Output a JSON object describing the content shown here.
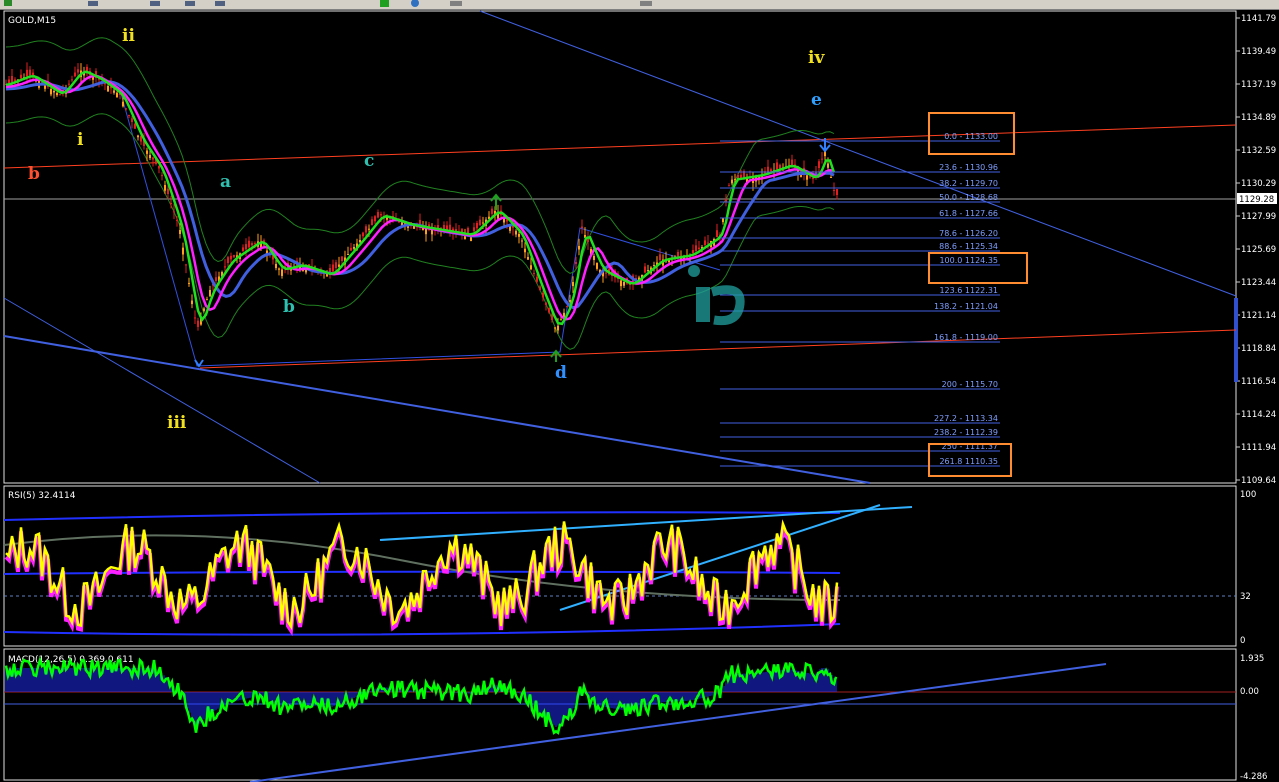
{
  "toolbar": {
    "buttons": [
      "arrow-icon",
      "zoom-icon",
      "crosshair-icon",
      "text-icon",
      "line-icon",
      "add-icon",
      "refresh-icon",
      "period-icon",
      "nav-icon"
    ]
  },
  "chart_title": "GOLD,M15",
  "price_axis": [
    "1141.79",
    "1139.49",
    "1137.19",
    "1134.89",
    "1132.59",
    "1130.29",
    "1127.99",
    "1125.69",
    "1123.44",
    "1121.14",
    "1118.84",
    "1116.54",
    "1114.24",
    "1111.94",
    "1109.64"
  ],
  "current_price": "1129.28",
  "wave_labels": [
    {
      "text": "ii",
      "color": "#f0e020"
    },
    {
      "text": "i",
      "color": "#f0e020"
    },
    {
      "text": "b",
      "color": "#ff5030"
    },
    {
      "text": "a",
      "color": "#30c0b0"
    },
    {
      "text": "c",
      "color": "#30c0b0"
    },
    {
      "text": "b",
      "color": "#30c0b0"
    },
    {
      "text": "iii",
      "color": "#f0e020"
    },
    {
      "text": "d",
      "color": "#3090ff"
    },
    {
      "text": "iv",
      "color": "#f0e020"
    },
    {
      "text": "e",
      "color": "#30a0ff"
    }
  ],
  "fib_levels": [
    "0.0 - 1133.00",
    "23.6 - 1130.96",
    "38.2 - 1129.70",
    "50.0 - 1128.68",
    "61.8 - 1127.66",
    "78.6 - 1126.20",
    "88.6 - 1125.34",
    "100.0 1124.35",
    "123.6 1122.31",
    "138.2 - 1121.04",
    "161.8 - 1119.00",
    "200 - 1115.70",
    "227.2 - 1113.34",
    "238.2 - 1112.39",
    "250 - 1111.37",
    "261.8 1110.35"
  ],
  "rsi": {
    "title": "RSI(5) 32.4114",
    "max": "100",
    "level": "32",
    "min": "0"
  },
  "macd": {
    "title": "MACD(12,26,5) 0.369 0.611",
    "max": "1.935",
    "zero": "0.00",
    "min": "-4.286"
  },
  "colors": {
    "background": "#000000",
    "price_line": "#ffffff",
    "fib": "#4060e0",
    "channel": "#ff4020",
    "trend": "#4060e0",
    "highlight": "#ff8c30",
    "rsi": "#ffff00",
    "macd": "#00ff00",
    "macd_hist": "#2020ff"
  }
}
